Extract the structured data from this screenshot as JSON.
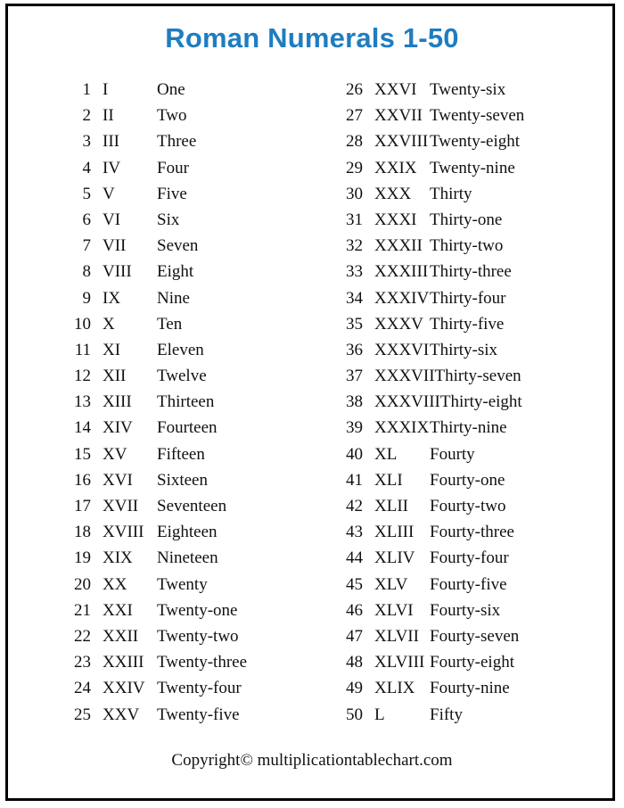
{
  "page": {
    "title": "Roman Numerals 1-50",
    "title_color": "#1f7dc0",
    "border_color": "#000000",
    "background_color": "#ffffff",
    "text_color": "#111111",
    "copyright": "Copyright© multiplicationtablechart.com"
  },
  "columns": {
    "left": [
      {
        "number": "1",
        "roman": "I",
        "word": "One"
      },
      {
        "number": "2",
        "roman": "II",
        "word": "Two"
      },
      {
        "number": "3",
        "roman": "III",
        "word": "Three"
      },
      {
        "number": "4",
        "roman": "IV",
        "word": "Four"
      },
      {
        "number": "5",
        "roman": "V",
        "word": "Five"
      },
      {
        "number": "6",
        "roman": "VI",
        "word": "Six"
      },
      {
        "number": "7",
        "roman": "VII",
        "word": "Seven"
      },
      {
        "number": "8",
        "roman": "VIII",
        "word": "Eight"
      },
      {
        "number": "9",
        "roman": "IX",
        "word": "Nine"
      },
      {
        "number": "10",
        "roman": "X",
        "word": "Ten"
      },
      {
        "number": "11",
        "roman": "XI",
        "word": "Eleven"
      },
      {
        "number": "12",
        "roman": "XII",
        "word": "Twelve"
      },
      {
        "number": "13",
        "roman": "XIII",
        "word": "Thirteen"
      },
      {
        "number": "14",
        "roman": "XIV",
        "word": "Fourteen"
      },
      {
        "number": "15",
        "roman": "XV",
        "word": "Fifteen"
      },
      {
        "number": "16",
        "roman": "XVI",
        "word": "Sixteen"
      },
      {
        "number": "17",
        "roman": "XVII",
        "word": "Seventeen"
      },
      {
        "number": "18",
        "roman": "XVIII",
        "word": "Eighteen"
      },
      {
        "number": "19",
        "roman": "XIX",
        "word": "Nineteen"
      },
      {
        "number": "20",
        "roman": "XX",
        "word": "Twenty"
      },
      {
        "number": "21",
        "roman": "XXI",
        "word": "Twenty-one"
      },
      {
        "number": "22",
        "roman": "XXII",
        "word": "Twenty-two"
      },
      {
        "number": "23",
        "roman": "XXIII",
        "word": "Twenty-three"
      },
      {
        "number": "24",
        "roman": "XXIV",
        "word": "Twenty-four"
      },
      {
        "number": "25",
        "roman": "XXV",
        "word": "Twenty-five"
      }
    ],
    "right": [
      {
        "number": "26",
        "roman": "XXVI",
        "word": "Twenty-six"
      },
      {
        "number": "27",
        "roman": "XXVII",
        "word": "Twenty-seven"
      },
      {
        "number": "28",
        "roman": "XXVIII",
        "word": "Twenty-eight"
      },
      {
        "number": "29",
        "roman": "XXIX",
        "word": "Twenty-nine"
      },
      {
        "number": "30",
        "roman": "XXX",
        "word": "Thirty"
      },
      {
        "number": "31",
        "roman": "XXXI",
        "word": "Thirty-one"
      },
      {
        "number": "32",
        "roman": "XXXII",
        "word": "Thirty-two"
      },
      {
        "number": "33",
        "roman": "XXXIII",
        "word": "Thirty-three"
      },
      {
        "number": "34",
        "roman": "XXXIV",
        "word": "Thirty-four"
      },
      {
        "number": "35",
        "roman": "XXXV",
        "word": "Thirty-five"
      },
      {
        "number": "36",
        "roman": "XXXVI",
        "word": "Thirty-six"
      },
      {
        "number": "37",
        "roman": "XXXVII",
        "word": "Thirty-seven"
      },
      {
        "number": "38",
        "roman": "XXXVIII",
        "word": "Thirty-eight"
      },
      {
        "number": "39",
        "roman": "XXXIX",
        "word": "Thirty-nine"
      },
      {
        "number": "40",
        "roman": "XL",
        "word": "Fourty"
      },
      {
        "number": "41",
        "roman": "XLI",
        "word": "Fourty-one"
      },
      {
        "number": "42",
        "roman": "XLII",
        "word": "Fourty-two"
      },
      {
        "number": "43",
        "roman": "XLIII",
        "word": "Fourty-three"
      },
      {
        "number": "44",
        "roman": "XLIV",
        "word": "Fourty-four"
      },
      {
        "number": "45",
        "roman": "XLV",
        "word": "Fourty-five"
      },
      {
        "number": "46",
        "roman": "XLVI",
        "word": "Fourty-six"
      },
      {
        "number": "47",
        "roman": "XLVII",
        "word": "Fourty-seven"
      },
      {
        "number": "48",
        "roman": "XLVIII",
        "word": "Fourty-eight"
      },
      {
        "number": "49",
        "roman": "XLIX",
        "word": "Fourty-nine"
      },
      {
        "number": "50",
        "roman": "L",
        "word": "Fifty"
      }
    ]
  }
}
